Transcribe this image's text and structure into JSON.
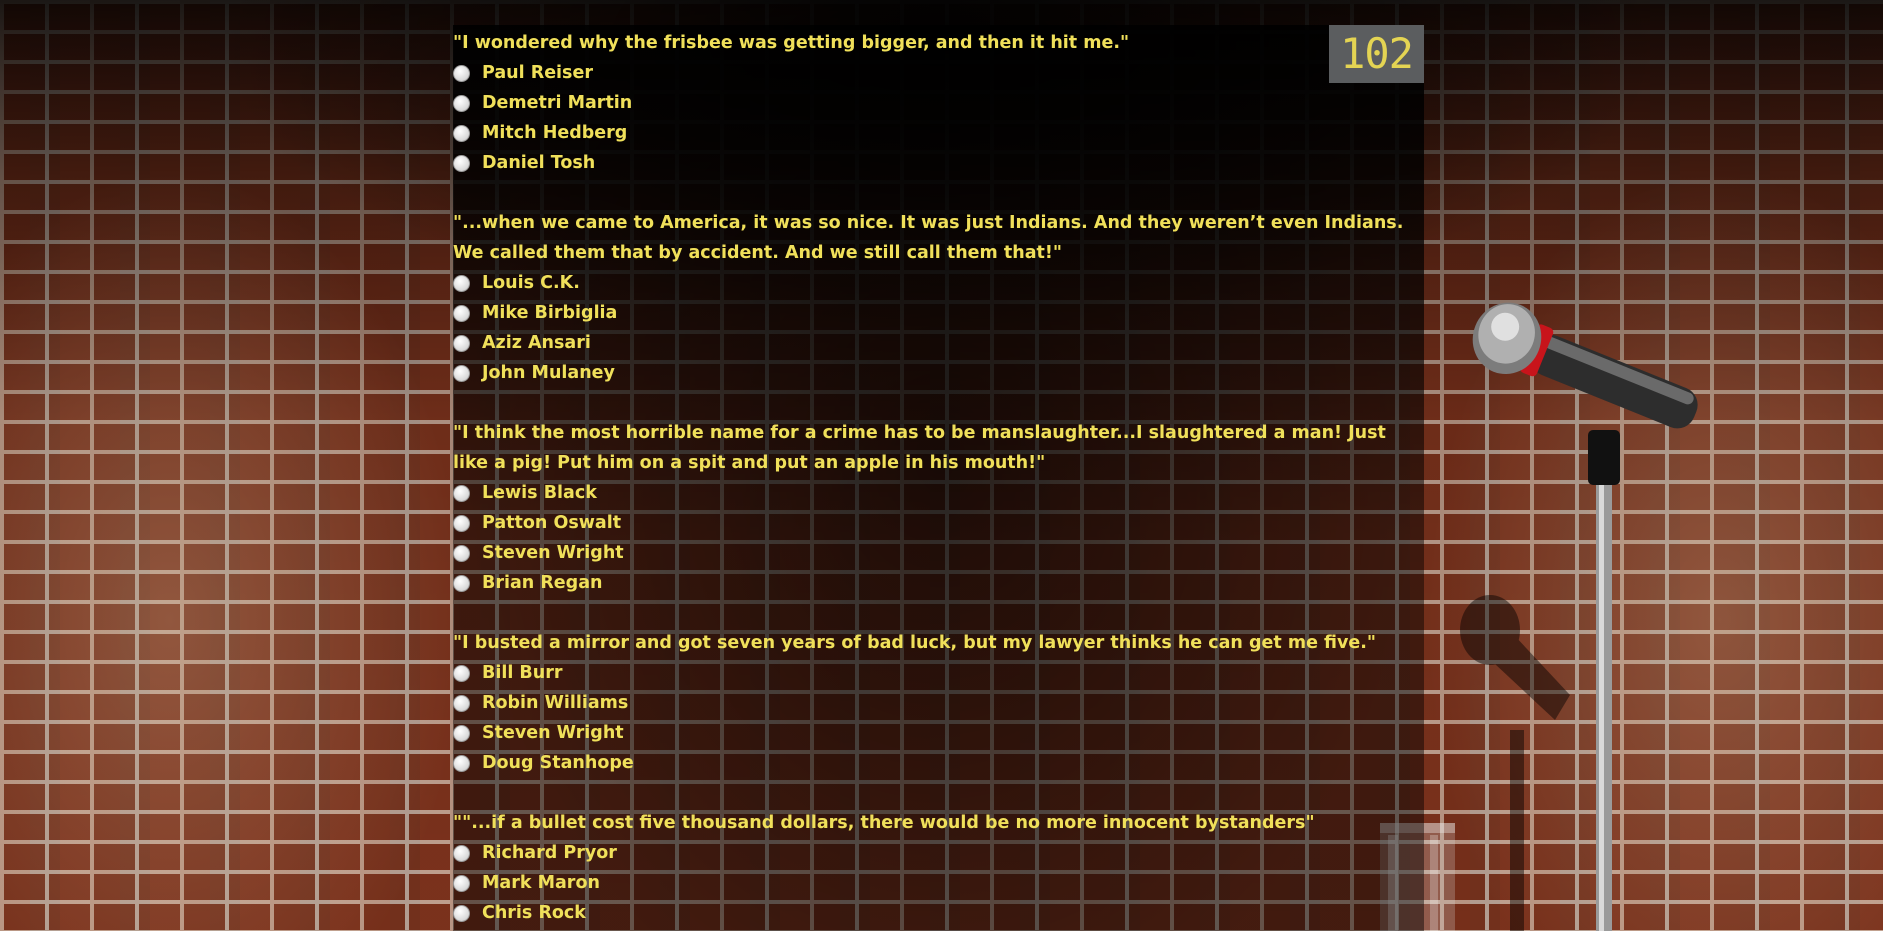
{
  "score": "102",
  "questions": [
    {
      "text": "\"I wondered why the frisbee was getting bigger, and then it hit me.\"",
      "options": [
        "Paul Reiser",
        "Demetri Martin",
        "Mitch Hedberg",
        "Daniel Tosh"
      ]
    },
    {
      "text": "\"...when we came to America, it was so nice. It was just Indians. And they weren’t even Indians. We called them that by accident. And we still call them that!\"",
      "options": [
        "Louis C.K.",
        "Mike Birbiglia",
        "Aziz Ansari",
        "John Mulaney"
      ]
    },
    {
      "text": "\"I think the most horrible name for a crime has to be manslaughter...I slaughtered a man! Just like a pig! Put him on a spit and put an apple in his mouth!\"",
      "options": [
        "Lewis Black",
        "Patton Oswalt",
        "Steven Wright",
        "Brian Regan"
      ]
    },
    {
      "text": "\"I busted a mirror and got seven years of bad luck, but my lawyer thinks he can get me five.\"",
      "options": [
        "Bill Burr",
        "Robin Williams",
        "Steven Wright",
        "Doug Stanhope"
      ]
    },
    {
      "text": "\"\"...if a bullet cost five thousand dollars, there would be no more innocent bystanders\"",
      "options": [
        "Richard Pryor",
        "Mark Maron",
        "Chris Rock"
      ]
    }
  ],
  "colors": {
    "text": "#f0e05a",
    "score_bg": "#5b5d5f",
    "score_text": "#e4d453"
  },
  "icons": {
    "microphone": "microphone-stand-icon",
    "glass": "water-glass-icon"
  }
}
